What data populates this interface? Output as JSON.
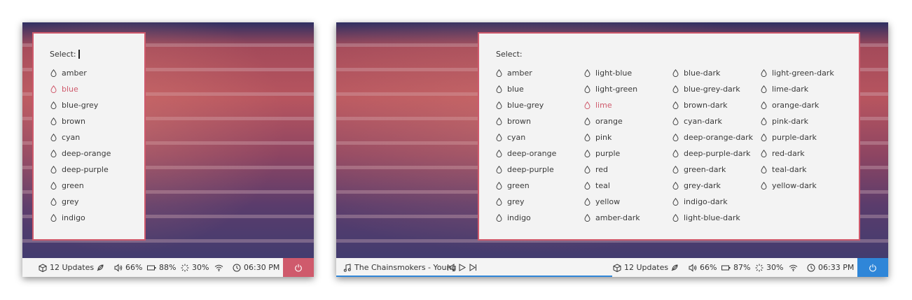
{
  "left": {
    "prompt": "Select:",
    "items": [
      "amber",
      "blue",
      "blue-grey",
      "brown",
      "cyan",
      "deep-orange",
      "deep-purple",
      "green",
      "grey",
      "indigo"
    ],
    "selected_index": 1,
    "bar": {
      "updates": "12 Updates",
      "volume": "66%",
      "battery": "88%",
      "cpu": "30%",
      "clock": "06:30 PM"
    },
    "accent": "#cf5a6c"
  },
  "right": {
    "prompt": "Select:",
    "columns": [
      [
        "amber",
        "blue",
        "blue-grey",
        "brown",
        "cyan",
        "deep-orange",
        "deep-purple",
        "green",
        "grey",
        "indigo"
      ],
      [
        "light-blue",
        "light-green",
        "lime",
        "orange",
        "pink",
        "purple",
        "red",
        "teal",
        "yellow",
        "amber-dark"
      ],
      [
        "blue-dark",
        "blue-grey-dark",
        "brown-dark",
        "cyan-dark",
        "deep-orange-dark",
        "deep-purple-dark",
        "green-dark",
        "grey-dark",
        "indigo-dark",
        "light-blue-dark"
      ],
      [
        "light-green-dark",
        "lime-dark",
        "orange-dark",
        "pink-dark",
        "purple-dark",
        "red-dark",
        "teal-dark",
        "yellow-dark"
      ]
    ],
    "selected": "lime",
    "bar": {
      "music": "The Chainsmokers - Young",
      "updates": "12 Updates",
      "volume": "66%",
      "battery": "87%",
      "cpu": "30%",
      "clock": "06:33 PM"
    },
    "accent": "#2f86d8"
  },
  "icons": [
    "package-icon",
    "feather-icon",
    "volume-icon",
    "battery-icon",
    "cpu-spinner-icon",
    "wifi-icon",
    "clock-icon",
    "power-icon",
    "music-note-icon",
    "previous-icon",
    "play-icon",
    "next-icon",
    "drop-icon"
  ]
}
